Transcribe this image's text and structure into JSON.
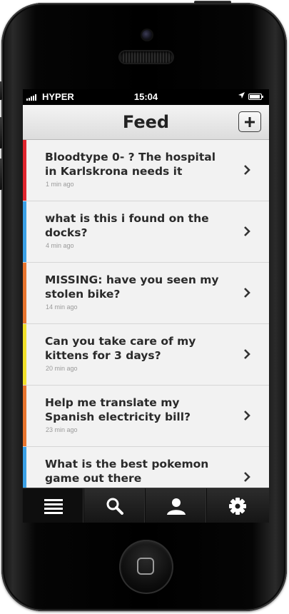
{
  "status_bar": {
    "carrier": "HYPER",
    "time": "15:04"
  },
  "nav": {
    "title": "Feed",
    "add_icon": "plus-icon"
  },
  "feed": [
    {
      "title": "Bloodtype 0- ? The hospital in Karlskrona needs it",
      "time": "1 min ago",
      "color": "#e0252e"
    },
    {
      "title": "what is this i found on the docks?",
      "time": "4 min ago",
      "color": "#3aa0e6"
    },
    {
      "title": "MISSING: have you seen my stolen bike?",
      "time": "14 min ago",
      "color": "#e8742e"
    },
    {
      "title": "Can you take care of my kittens for 3 days?",
      "time": "20 min ago",
      "color": "#f2e12a"
    },
    {
      "title": "Help me translate my Spanish electricity bill?",
      "time": "23 min ago",
      "color": "#e8742e"
    },
    {
      "title": "What is the best pokemon game out there",
      "time": "",
      "color": "#3aa0e6"
    }
  ],
  "tabs": [
    {
      "icon": "list-icon",
      "active": true
    },
    {
      "icon": "search-icon",
      "active": false
    },
    {
      "icon": "user-icon",
      "active": false
    },
    {
      "icon": "gear-icon",
      "active": false
    }
  ]
}
